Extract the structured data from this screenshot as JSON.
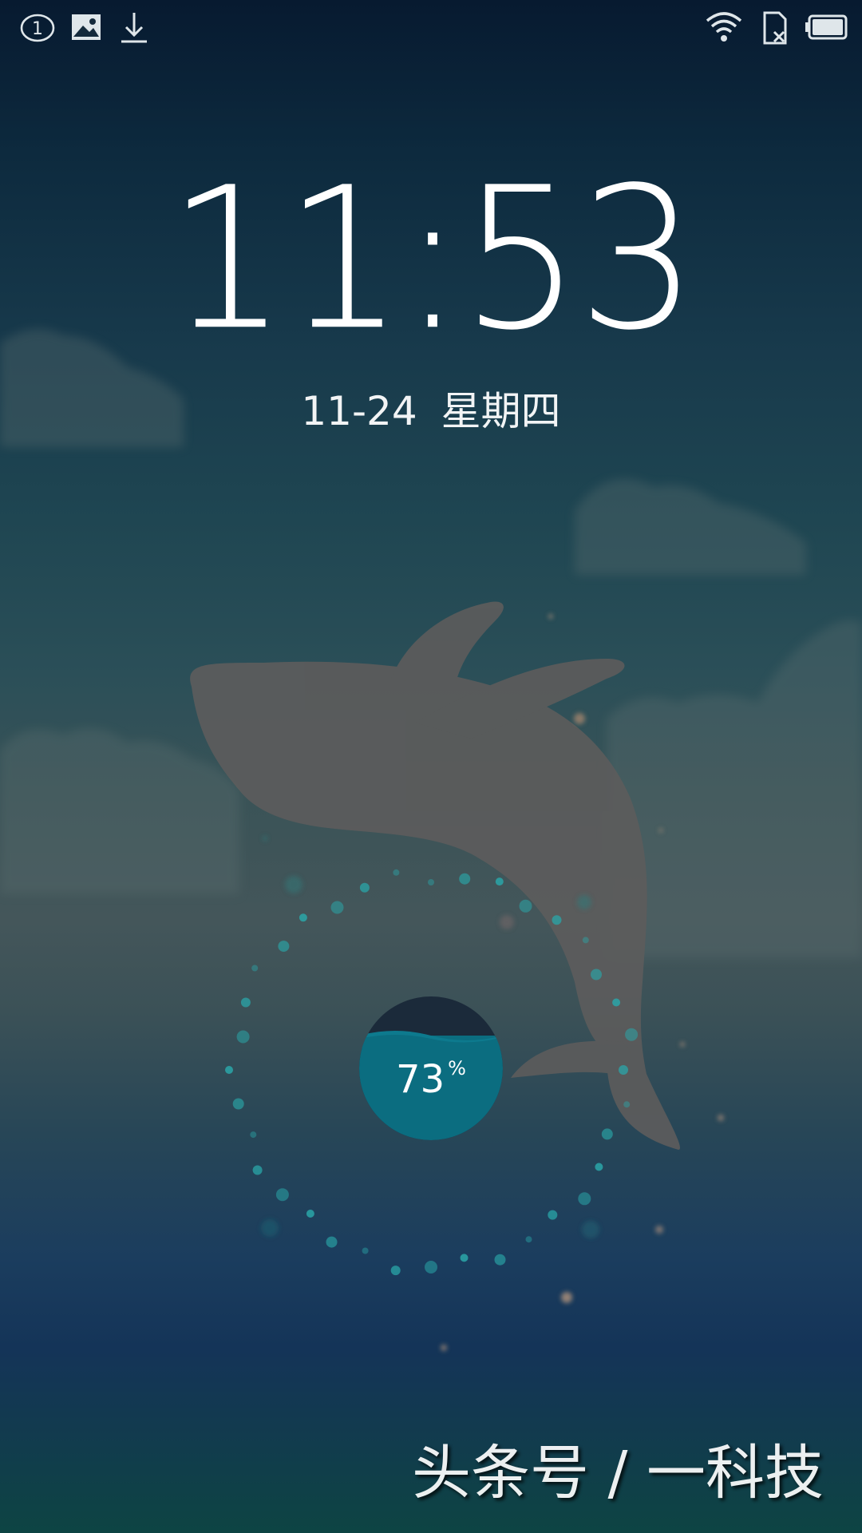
{
  "status_bar": {
    "notification_count": "1",
    "left_icons": [
      "notification-count-icon",
      "image-icon",
      "download-icon"
    ],
    "right_icons": [
      "wifi-icon",
      "no-sim-icon",
      "battery-icon"
    ]
  },
  "lockscreen": {
    "time": "11:53",
    "date": "11-24",
    "weekday": "星期四",
    "wallpaper": "whale-in-clouds"
  },
  "battery": {
    "level": 73,
    "value_text": "73",
    "unit": "%"
  },
  "watermark": {
    "text": "头条号 / 一科技"
  },
  "colors": {
    "water": "#0b6d80",
    "ring_dot": "#2aa6a8",
    "whale": "#5a5a5a",
    "sky_top": "#071a30"
  }
}
